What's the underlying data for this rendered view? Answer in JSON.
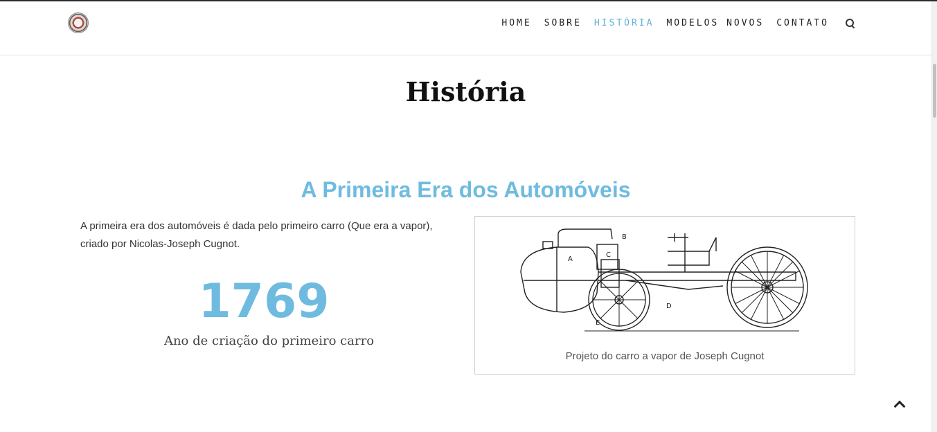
{
  "nav": {
    "items": [
      {
        "label": "HOME"
      },
      {
        "label": "SOBRE"
      },
      {
        "label": "HISTÓRIA"
      },
      {
        "label": "MODELOS NOVOS"
      },
      {
        "label": "CONTATO"
      }
    ],
    "active": "HISTÓRIA",
    "search_icon": "search-icon"
  },
  "page": {
    "title": "História"
  },
  "section": {
    "title": "A Primeira Era dos Automóveis",
    "intro": "A primeira era dos automóveis é dada pelo primeiro carro (Que era a vapor), criado por Nicolas-Joseph Cugnot.",
    "year": "1769",
    "year_caption": "Ano de criação do primeiro carro"
  },
  "figure": {
    "caption": "Projeto do carro a vapor de Joseph Cugnot",
    "labels": [
      "A",
      "B",
      "C",
      "D",
      "E"
    ]
  },
  "colors": {
    "accent": "#6fbbe0",
    "nav_active": "#5fb2d9",
    "text": "#333333"
  },
  "icons": {
    "back_to_top": "chevron-up-icon",
    "logo": "logo-emblem"
  }
}
